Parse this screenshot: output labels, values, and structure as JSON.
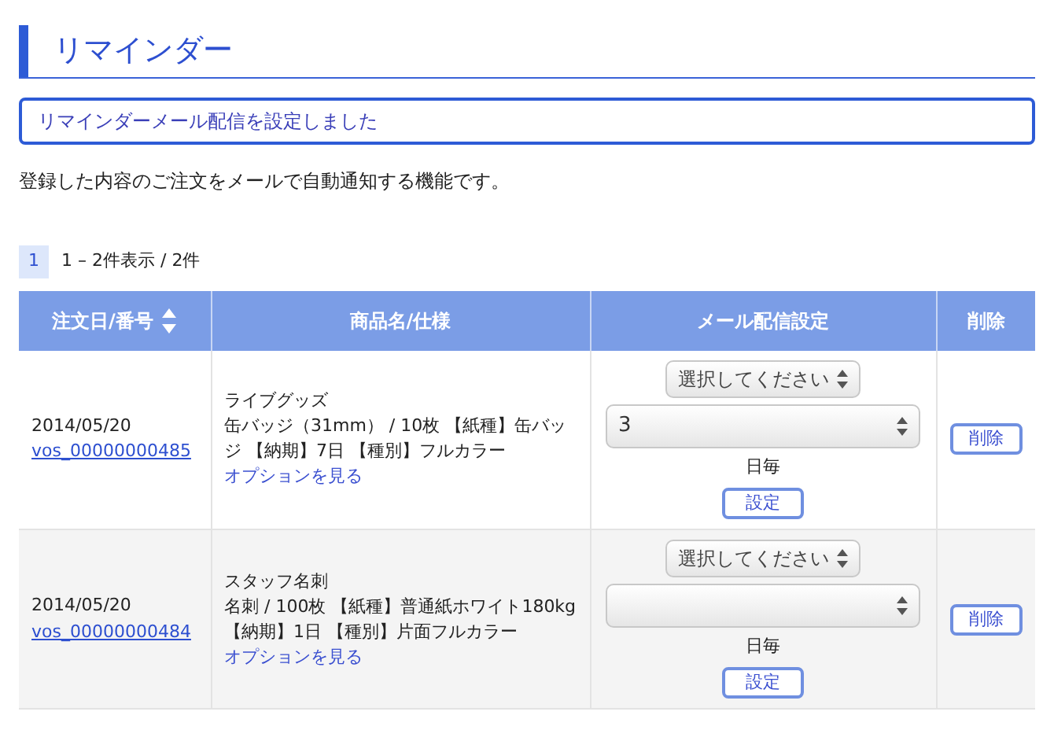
{
  "title": "リマインダー",
  "message": "リマインダーメール配信を設定しました",
  "description": "登録した内容のご注文をメールで自動通知する機能です。",
  "pagination": {
    "pages": [
      {
        "label": "1",
        "selected": true
      }
    ],
    "summary": "1 – 2件表示 / 2件"
  },
  "table": {
    "columns": [
      {
        "label": "注文日/番号",
        "sortable": true
      },
      {
        "label": "商品名/仕様",
        "sortable": false
      },
      {
        "label": "メール配信設定",
        "sortable": false
      },
      {
        "label": "削除",
        "sortable": false
      }
    ],
    "rows": [
      {
        "date": "2014/05/20",
        "order_no": "vos_00000000485",
        "product": "ライブグッズ",
        "spec": "缶バッジ（31mm） / 10枚 【紙種】缶バッジ 【納期】7日 【種別】フルカラー",
        "option_link": "オプションを見る",
        "schedule_select": "選択してください",
        "interval_select": "3",
        "interval_unit": "日毎",
        "set_button": "設定",
        "delete_button": "削除"
      },
      {
        "date": "2014/05/20",
        "order_no": "vos_00000000484",
        "product": "スタッフ名刺",
        "spec": "名刺 / 100枚 【紙種】普通紙ホワイト180kg 【納期】1日 【種別】片面フルカラー",
        "option_link": "オプションを見る",
        "schedule_select": "選択してください",
        "interval_unit": "日毎",
        "set_button": "設定",
        "delete_button": "削除"
      }
    ]
  }
}
